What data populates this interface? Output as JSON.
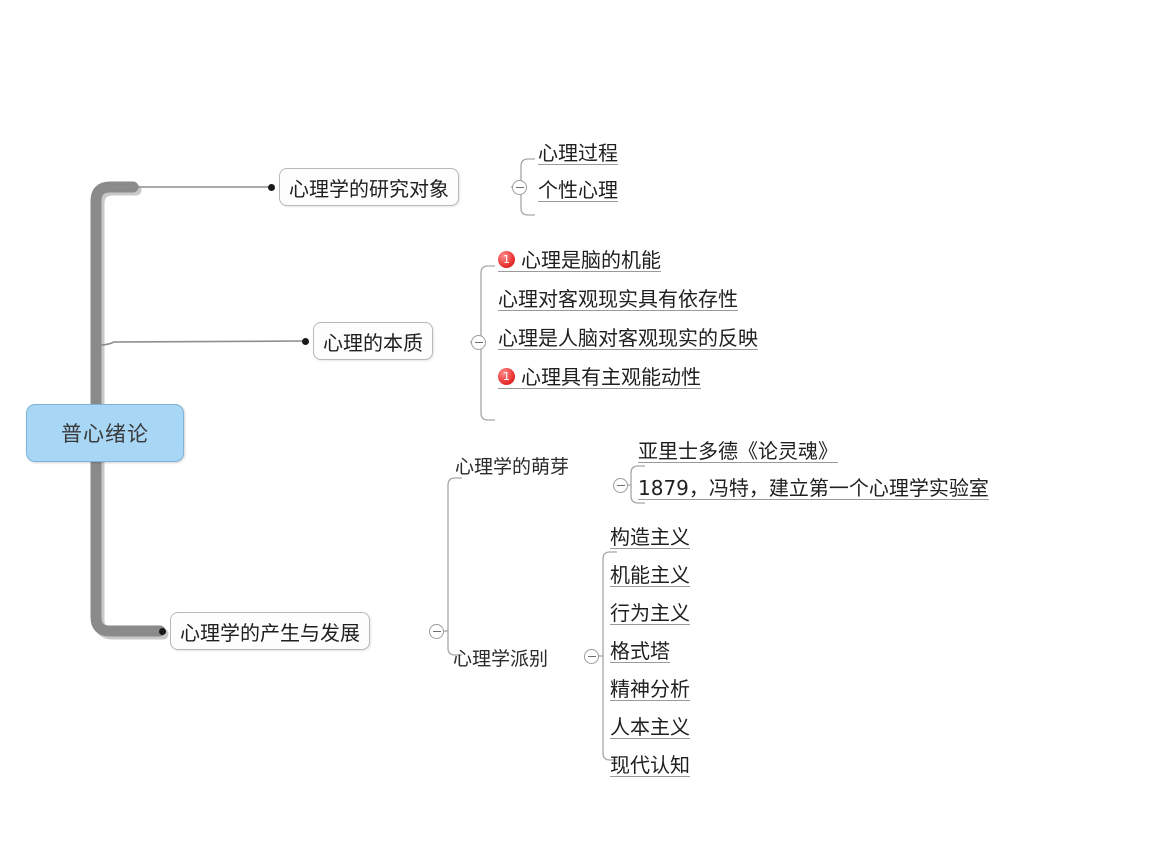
{
  "diagram": {
    "type": "mind-map",
    "title": "普心绪论",
    "orientation": "left-to-right",
    "background_color": "#ffffff",
    "root_fill_color": "#a8d6f5",
    "root_border_color": "#7fb4d8",
    "trunk_color": "#8a8a8a",
    "connector_color": "#9a9a9a",
    "badge_color": "#e8312f"
  },
  "root": {
    "label": "普心绪论"
  },
  "branches": [
    {
      "id": "branch-research-object",
      "label": "心理学的研究对象",
      "style": "boxed",
      "toggle": "collapse-minus",
      "children": [
        {
          "label": "心理过程",
          "badge": null
        },
        {
          "label": "个性心理",
          "badge": null
        }
      ]
    },
    {
      "id": "branch-essence",
      "label": "心理的本质",
      "style": "boxed",
      "toggle": "collapse-minus",
      "children": [
        {
          "label": "心理是脑的机能",
          "badge": "1"
        },
        {
          "label": "心理对客观现实具有依存性",
          "badge": null
        },
        {
          "label": "心理是人脑对客观现实的反映",
          "badge": null
        },
        {
          "label": "心理具有主观能动性",
          "badge": "1"
        }
      ]
    },
    {
      "id": "branch-origin-development",
      "label": "心理学的产生与发展",
      "style": "boxed",
      "toggle": "collapse-minus",
      "children": [
        {
          "id": "sub-sprout",
          "label": "心理学的萌芽",
          "style": "plain",
          "toggle": "collapse-minus",
          "children": [
            {
              "label": "亚里士多德《论灵魂》",
              "badge": null
            },
            {
              "label": "1879，冯特，建立第一个心理学实验室",
              "badge": null
            }
          ]
        },
        {
          "id": "sub-schools",
          "label": "心理学派别",
          "style": "plain",
          "toggle": "collapse-minus",
          "children": [
            {
              "label": "构造主义",
              "badge": null
            },
            {
              "label": "机能主义",
              "badge": null
            },
            {
              "label": "行为主义",
              "badge": null
            },
            {
              "label": "格式塔",
              "badge": null
            },
            {
              "label": "精神分析",
              "badge": null
            },
            {
              "label": "人本主义",
              "badge": null
            },
            {
              "label": "现代认知",
              "badge": null
            }
          ]
        }
      ]
    }
  ]
}
